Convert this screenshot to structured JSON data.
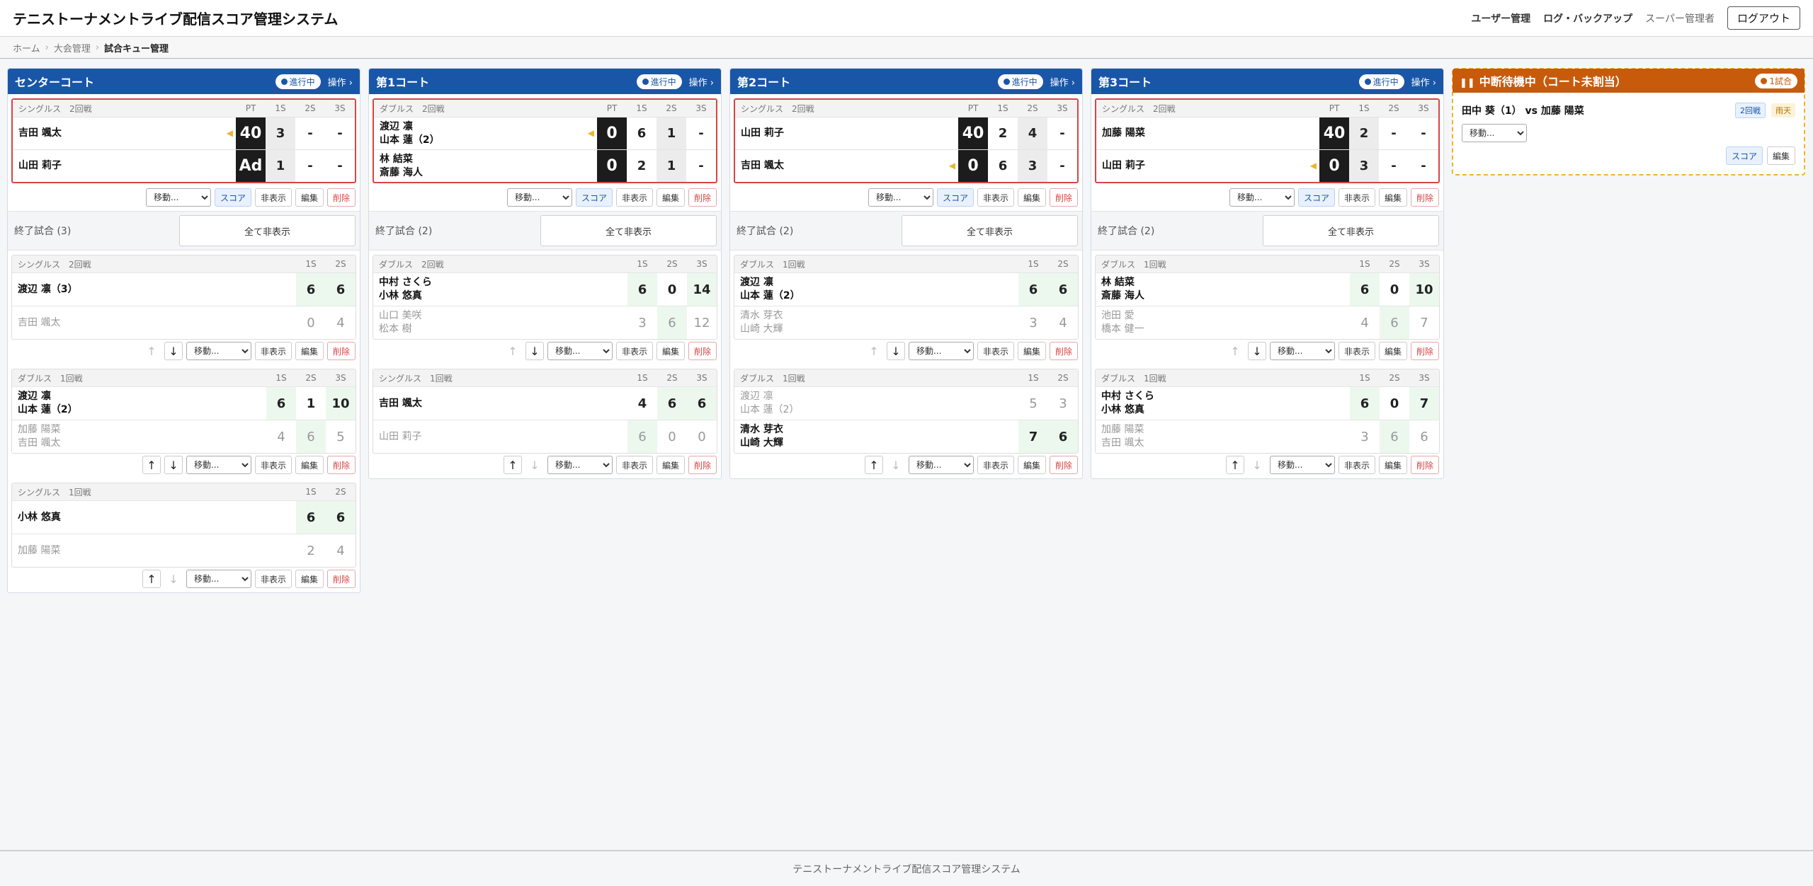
{
  "header": {
    "title": "テニストーナメントライブ配信スコア管理システム",
    "nav": [
      "ユーザー管理",
      "ログ・バックアップ"
    ],
    "role": "スーパー管理者",
    "logout": "ログアウト"
  },
  "breadcrumb": [
    "ホーム",
    "大会管理",
    "試合キュー管理"
  ],
  "labels": {
    "pt": "PT",
    "s1": "1S",
    "s2": "2S",
    "s3": "3S",
    "move": "移動...",
    "score": "スコア",
    "hide": "非表示",
    "edit": "編集",
    "del": "削除",
    "hide_all": "全て非表示",
    "status": "進行中",
    "ops": "操作 ›",
    "up": "↑",
    "down": "↓"
  },
  "courts": [
    {
      "name": "センターコート",
      "live": {
        "type": "シングルス　2回戦",
        "rows": [
          {
            "name": "吉田 颯太",
            "serve": true,
            "pt": "40",
            "sets": [
              "3",
              "-",
              "-"
            ]
          },
          {
            "name": "山田 莉子",
            "serve": false,
            "pt": "Ad",
            "sets": [
              "1",
              "-",
              "-"
            ]
          }
        ]
      },
      "finished_label": "終了試合 (3)",
      "finished": [
        {
          "type": "シングルス　2回戦",
          "rows": [
            {
              "name": "渡辺 凛（3）",
              "sets": [
                "6",
                "6"
              ]
            },
            {
              "name": "吉田 颯太",
              "sets": [
                "0",
                "4"
              ]
            }
          ]
        },
        {
          "type": "ダブルス　1回戦",
          "rows": [
            {
              "name": "渡辺 凛",
              "name2": "山本 蓮（2）",
              "sets": [
                "6",
                "1",
                "10"
              ]
            },
            {
              "name": "加藤 陽菜",
              "name2": "吉田 颯太",
              "sets": [
                "4",
                "6",
                "5"
              ]
            }
          ]
        },
        {
          "type": "シングルス　1回戦",
          "rows": [
            {
              "name": "小林 悠真",
              "sets": [
                "6",
                "6"
              ]
            },
            {
              "name": "加藤 陽菜",
              "sets": [
                "2",
                "4"
              ]
            }
          ]
        }
      ]
    },
    {
      "name": "第1コート",
      "live": {
        "type": "ダブルス　2回戦",
        "rows": [
          {
            "name": "渡辺 凛",
            "name2": "山本 蓮（2）",
            "serve": true,
            "pt": "0",
            "sets": [
              "6",
              "1",
              "-"
            ]
          },
          {
            "name": "林 結菜",
            "name2": "斎藤 海人",
            "serve": false,
            "pt": "0",
            "sets": [
              "2",
              "1",
              "-"
            ]
          }
        ]
      },
      "finished_label": "終了試合 (2)",
      "finished": [
        {
          "type": "ダブルス　2回戦",
          "rows": [
            {
              "name": "中村 さくら",
              "name2": "小林 悠真",
              "sets": [
                "6",
                "0",
                "14"
              ]
            },
            {
              "name": "山口 美咲",
              "name2": "松本 樹",
              "sets": [
                "3",
                "6",
                "12"
              ]
            }
          ]
        },
        {
          "type": "シングルス　1回戦",
          "rows": [
            {
              "name": "吉田 颯太",
              "sets": [
                "4",
                "6",
                "6"
              ]
            },
            {
              "name": "山田 莉子",
              "sets": [
                "6",
                "0",
                "0"
              ]
            }
          ]
        }
      ]
    },
    {
      "name": "第2コート",
      "live": {
        "type": "シングルス　2回戦",
        "rows": [
          {
            "name": "山田 莉子",
            "serve": false,
            "pt": "40",
            "sets": [
              "2",
              "4",
              "-"
            ]
          },
          {
            "name": "吉田 颯太",
            "serve": true,
            "pt": "0",
            "sets": [
              "6",
              "3",
              "-"
            ]
          }
        ]
      },
      "finished_label": "終了試合 (2)",
      "finished": [
        {
          "type": "ダブルス　1回戦",
          "rows": [
            {
              "name": "渡辺 凛",
              "name2": "山本 蓮（2）",
              "sets": [
                "6",
                "6"
              ]
            },
            {
              "name": "清水 芽衣",
              "name2": "山崎 大輝",
              "sets": [
                "3",
                "4"
              ]
            }
          ]
        },
        {
          "type": "ダブルス　1回戦",
          "rows": [
            {
              "name": "渡辺 凛",
              "name2": "山本 蓮（2）",
              "sets": [
                "5",
                "3"
              ]
            },
            {
              "name": "清水 芽衣",
              "name2": "山崎 大輝",
              "sets": [
                "7",
                "6"
              ]
            }
          ]
        }
      ]
    },
    {
      "name": "第3コート",
      "live": {
        "type": "シングルス　2回戦",
        "rows": [
          {
            "name": "加藤 陽菜",
            "serve": false,
            "pt": "40",
            "sets": [
              "2",
              "-",
              "-"
            ]
          },
          {
            "name": "山田 莉子",
            "serve": true,
            "pt": "0",
            "sets": [
              "3",
              "-",
              "-"
            ]
          }
        ]
      },
      "finished_label": "終了試合 (2)",
      "finished": [
        {
          "type": "ダブルス　1回戦",
          "rows": [
            {
              "name": "林 結菜",
              "name2": "斎藤 海人",
              "sets": [
                "6",
                "0",
                "10"
              ]
            },
            {
              "name": "池田 愛",
              "name2": "橋本 健一",
              "sets": [
                "4",
                "6",
                "7"
              ]
            }
          ]
        },
        {
          "type": "ダブルス　1回戦",
          "rows": [
            {
              "name": "中村 さくら",
              "name2": "小林 悠真",
              "sets": [
                "6",
                "0",
                "7"
              ]
            },
            {
              "name": "加藤 陽菜",
              "name2": "吉田 颯太",
              "sets": [
                "3",
                "6",
                "6"
              ]
            }
          ]
        }
      ]
    }
  ],
  "suspended": {
    "title": "中断待機中（コート未割当）",
    "count": "1試合",
    "match": "田中 葵（1） vs 加藤 陽菜",
    "round": "2回戦",
    "reason": "雨天"
  },
  "footer": "テニストーナメントライブ配信スコア管理システム"
}
